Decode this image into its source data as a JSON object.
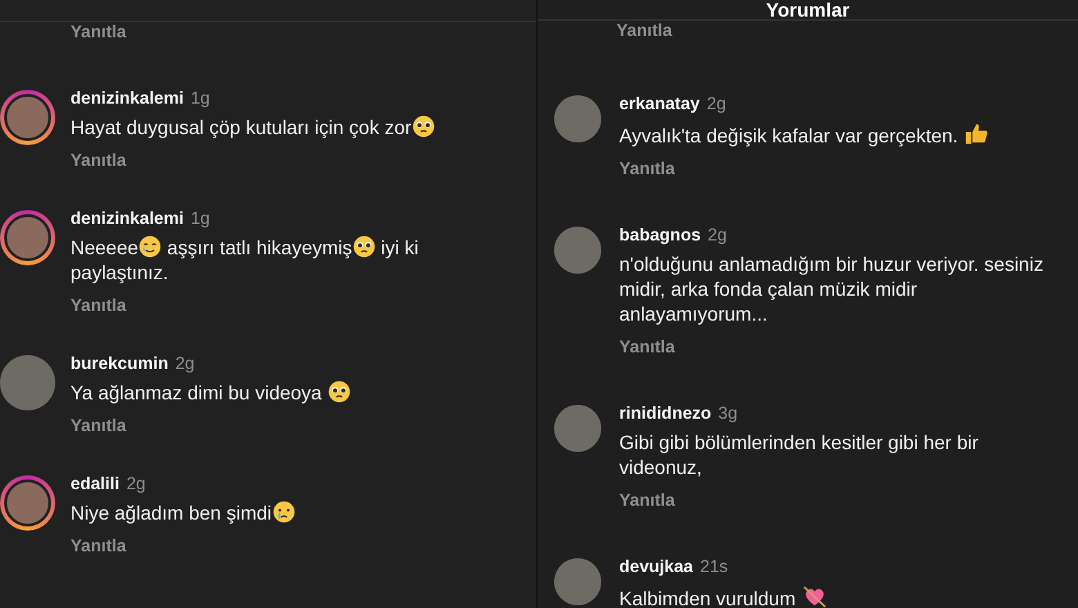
{
  "panels": [
    {
      "top_reply": "Yanıtla",
      "comments": [
        {
          "username": "denizinkalemi",
          "time": "1g",
          "story": true,
          "parts": [
            {
              "kind": "text",
              "text": "Hayat duygusal çöp kutuları için çok zor"
            },
            {
              "kind": "pleading"
            }
          ],
          "reply": "Yanıtla"
        },
        {
          "username": "denizinkalemi",
          "time": "1g",
          "story": true,
          "parts": [
            {
              "kind": "text",
              "text": "Neeeee"
            },
            {
              "kind": "smiletear"
            },
            {
              "kind": "text",
              "text": " aşşırı tatlı hikayeymiş"
            },
            {
              "kind": "pleading"
            },
            {
              "kind": "text",
              "text": " iyi ki paylaştınız."
            }
          ],
          "reply": "Yanıtla"
        },
        {
          "username": "burekcumin",
          "time": "2g",
          "story": false,
          "parts": [
            {
              "kind": "text",
              "text": "Ya ağlanmaz dimi bu videoya "
            },
            {
              "kind": "pleading"
            }
          ],
          "reply": "Yanıtla"
        },
        {
          "username": "edalili",
          "time": "2g",
          "story": true,
          "parts": [
            {
              "kind": "text",
              "text": "Niye ağladım ben şimdi"
            },
            {
              "kind": "crying"
            }
          ],
          "reply": "Yanıtla"
        }
      ]
    },
    {
      "header": {
        "title": "Yorumlar"
      },
      "top_reply": "Yanıtla",
      "comments": [
        {
          "username": "erkanatay",
          "time": "2g",
          "story": false,
          "parts": [
            {
              "kind": "text",
              "text": "Ayvalık'ta değişik kafalar var gerçekten. "
            },
            {
              "kind": "thumbsup"
            }
          ],
          "reply": "Yanıtla"
        },
        {
          "username": "babagnos",
          "time": "2g",
          "story": false,
          "parts": [
            {
              "kind": "text",
              "text": "n'olduğunu anlamadığım bir huzur veriyor. sesiniz midir, arka fonda çalan müzik midir anlayamıyorum..."
            }
          ],
          "reply": "Yanıtla"
        },
        {
          "username": "rinididnezo",
          "time": "3g",
          "story": false,
          "parts": [
            {
              "kind": "text",
              "text": "Gibi gibi bölümlerinden kesitler gibi her bir videonuz,"
            }
          ],
          "reply": "Yanıtla"
        },
        {
          "username": "devujkaa",
          "time": "21s",
          "story": false,
          "parts": [
            {
              "kind": "text",
              "text": "Kalbimden vuruldum "
            },
            {
              "kind": "heartarrow"
            }
          ]
        }
      ]
    }
  ]
}
